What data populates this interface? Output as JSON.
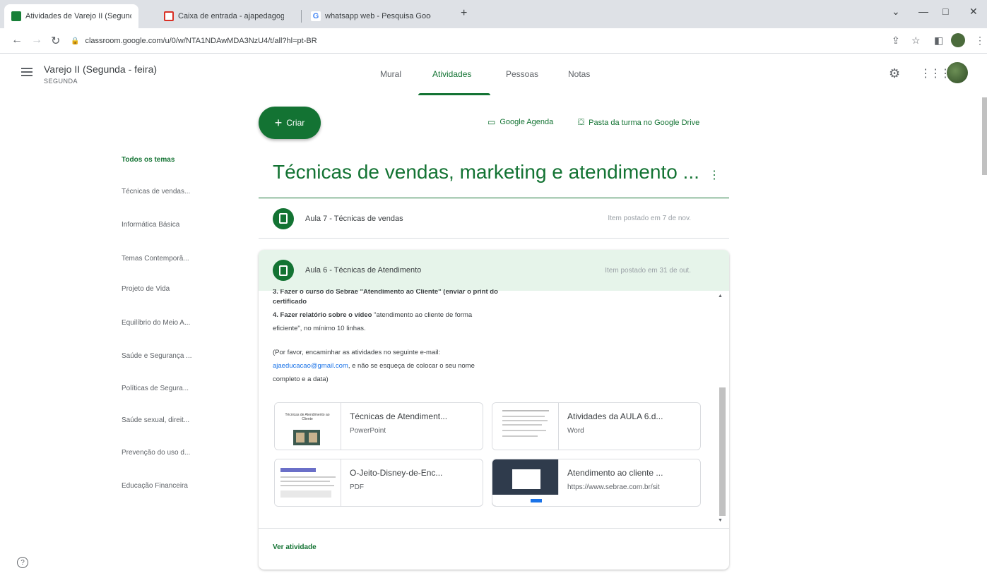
{
  "browser": {
    "tabs": [
      {
        "title": "Atividades de Varejo II (Segunda ×",
        "favicon_color": "#188038",
        "close": "×"
      },
      {
        "title": "Caixa de entrada - ajapedagogic ×",
        "favicon_color": "#d93025",
        "close": "×"
      },
      {
        "title": "whatsapp web - Pesquisa Google ×",
        "favicon_color": "#4285f4",
        "close": "×"
      }
    ],
    "new_tab": "+",
    "url": "classroom.google.com/u/0/w/NTA1NDAwMDA3NzU4/t/all?hl=pt-BR",
    "controls": {
      "minimize": "—",
      "maximize": "□",
      "close": "✕",
      "menu": "⌄"
    }
  },
  "header": {
    "class_name": "Varejo II (Segunda - feira)",
    "section": "SEGUNDA",
    "tabs": [
      "Mural",
      "Atividades",
      "Pessoas",
      "Notas"
    ],
    "active_tab": "Atividades"
  },
  "toolbar": {
    "create_label": "Criar",
    "calendar_link": "Google Agenda",
    "drive_link": "Pasta da turma no Google Drive"
  },
  "topics": [
    "Todos os temas",
    "Técnicas de vendas...",
    "Informática Básica",
    "Temas Contemporâ...",
    "Projeto de Vida",
    "Equilíbrio do Meio A...",
    "Saúde e Segurança ...",
    "Políticas de Segura...",
    "Saúde sexual, direit...",
    "Prevenção do uso d...",
    "Educação Financeira"
  ],
  "topic_section": {
    "title": "Técnicas de vendas, marketing e atendimento ...",
    "more": "⋮"
  },
  "assignments": [
    {
      "title": "Aula 7 - Técnicas de vendas",
      "date": "Item postado em 7 de nov."
    },
    {
      "title": "Aula 6 - Técnicas de Atendimento",
      "date": "Item postado em 31 de out."
    }
  ],
  "description": {
    "cut_line": "3. Fazer o curso do Sebrae \"Atendimento ao Cliente\" (enviar o print do",
    "certificado": "certificado",
    "item4_bold": "4. Fazer relatório sobre o vídeo",
    "item4_text": " \"atendimento ao cliente de forma",
    "item4_cont": "eficiente\", no mínimo 10 linhas.",
    "note_start": "(Por favor, encaminhar as atividades no seguinte e-mail:",
    "email": "ajaeducacao@gmail.com",
    "note_mid": ", e não se esqueça de colocar o seu nome",
    "note_end": "completo e a data)"
  },
  "attachments": [
    {
      "name": "Técnicas de Atendiment...",
      "type": "PowerPoint",
      "thumb_text": "Técnicas de Atendimento ao Cliente"
    },
    {
      "name": "Atividades da AULA 6.d...",
      "type": "Word"
    },
    {
      "name": "O-Jeito-Disney-de-Enc...",
      "type": "PDF"
    },
    {
      "name": "Atendimento ao cliente ...",
      "type": "https://www.sebrae.com.br/sit"
    }
  ],
  "footer": {
    "see_activity": "Ver atividade"
  },
  "colors": {
    "accent": "#137333",
    "highlight": "#e6f4ea",
    "link": "#1a73e8"
  }
}
